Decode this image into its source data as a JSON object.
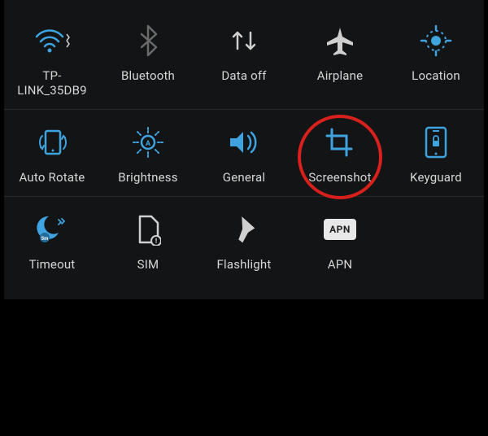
{
  "colors": {
    "accent": "#3fa3e0",
    "text": "#d6d6d6",
    "highlight": "#d8201c",
    "panel_bg": "#131415"
  },
  "rows": [
    {
      "tiles": [
        {
          "icon": "wifi-icon",
          "label": "TP-\nLINK_35DB9"
        },
        {
          "icon": "bluetooth-icon",
          "label": "Bluetooth"
        },
        {
          "icon": "data-off-icon",
          "label": "Data off"
        },
        {
          "icon": "airplane-icon",
          "label": "Airplane"
        },
        {
          "icon": "location-icon",
          "label": "Location"
        }
      ]
    },
    {
      "tiles": [
        {
          "icon": "auto-rotate-icon",
          "label": "Auto Rotate"
        },
        {
          "icon": "brightness-icon",
          "label": "Brightness"
        },
        {
          "icon": "sound-general-icon",
          "label": "General"
        },
        {
          "icon": "screenshot-icon",
          "label": "Screenshot",
          "highlighted": true
        },
        {
          "icon": "keyguard-icon",
          "label": "Keyguard"
        }
      ]
    },
    {
      "tiles": [
        {
          "icon": "timeout-icon",
          "label": "Timeout"
        },
        {
          "icon": "sim-icon",
          "label": "SIM"
        },
        {
          "icon": "flashlight-icon",
          "label": "Flashlight"
        },
        {
          "icon": "apn-icon",
          "label": "APN",
          "apn_text": "APN"
        }
      ]
    }
  ]
}
